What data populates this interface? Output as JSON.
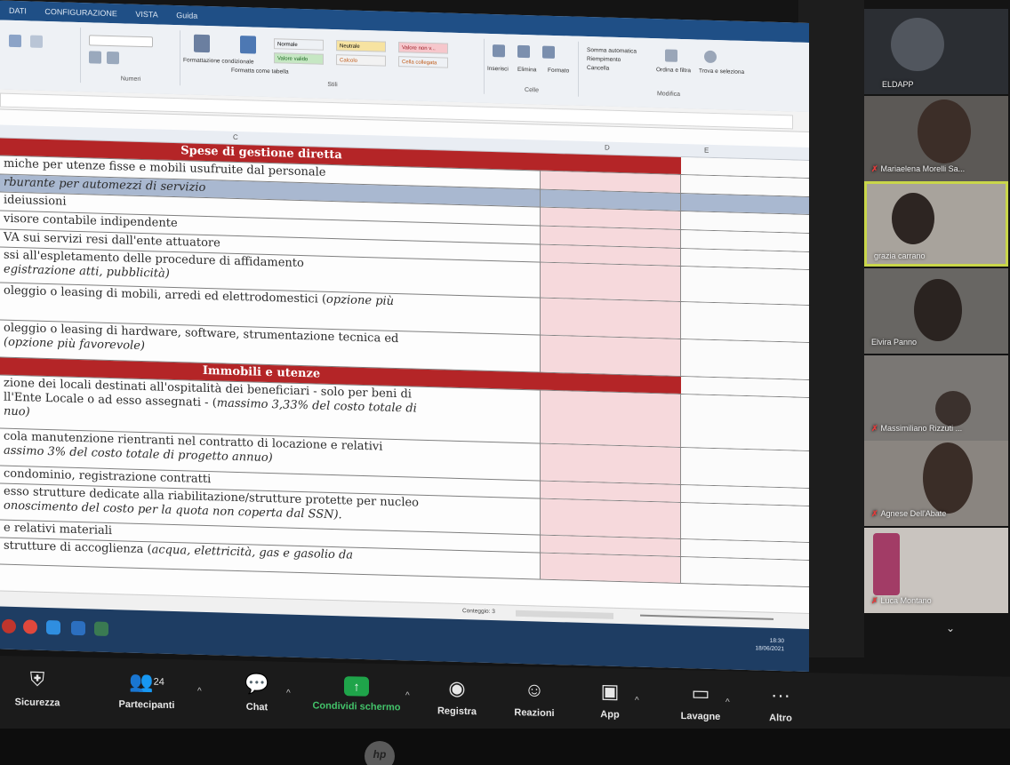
{
  "excel": {
    "titlebar": [
      "DATI",
      "CONFIGURAZIONE",
      "VISTA",
      "Guida"
    ],
    "ribbon": {
      "style_cells": [
        {
          "label": "Normale",
          "bg": "#ffffff"
        },
        {
          "label": "Neutrale",
          "bg": "#f7e3a1"
        },
        {
          "label": "Valore non v...",
          "bg": "#f6c7cc"
        },
        {
          "label": "Valore valido",
          "bg": "#c6e7c3"
        },
        {
          "label": "Calcolo",
          "bg": "#f2f2f2"
        },
        {
          "label": "Cella collegata",
          "bg": "#ffffff"
        }
      ],
      "groups": [
        "Numeri",
        "Stili",
        "Celle",
        "Modifica"
      ],
      "buttons": [
        "Formattazione condizionale",
        "Formatta come tabella",
        "Inserisci",
        "Elimina",
        "Formato",
        "Somma automatica",
        "Riempimento",
        "Cancella",
        "Ordina e filtra",
        "Trova e seleziona"
      ]
    },
    "columns": [
      "C",
      "D",
      "E"
    ],
    "rows": [
      {
        "type": "header",
        "text": "Spese di gestione diretta",
        "h": 20
      },
      {
        "type": "plain",
        "text": "miche per utenze fisse e mobili usufruite dal personale",
        "h": 21
      },
      {
        "type": "blue",
        "text": "rburante per automezzi di servizio",
        "h": 20
      },
      {
        "type": "plain",
        "text": "ideiussioni",
        "h": 21
      },
      {
        "type": "plain",
        "text": "visore contabile indipendente",
        "h": 21
      },
      {
        "type": "plain",
        "text": "VA sui servizi resi dall'ente attuatore",
        "h": 20
      },
      {
        "type": "plain",
        "text": "ssi all'espletamento delle procedure di affidamento",
        "text2_it": "egistrazione atti, pubblicità)",
        "h": 40
      },
      {
        "type": "plain",
        "text": "oleggio o leasing di mobili, arredi ed elettrodomestici (",
        "text_it": "opzione più",
        "h": 42
      },
      {
        "type": "plain",
        "text": "oleggio o leasing di hardware, software, strumentazione tecnica ed",
        "text2_it": "(opzione più favorevole)",
        "h": 42
      },
      {
        "type": "header",
        "text": "Immobili e utenze",
        "h": 20
      },
      {
        "type": "plain",
        "text": "zione dei locali destinati all'ospitalità dei beneficiari - solo per beni di",
        "text2": "ll'Ente Locale  o ad esso assegnati - (",
        "text2_it": "massimo 3,33% del costo totale di",
        "text3_it": "nuo)",
        "h": 60
      },
      {
        "type": "plain",
        "text": "cola manutenzione rientranti nel contratto di locazione e relativi",
        "text2_it": "assimo 3% del costo totale di progetto annuo)",
        "h": 42
      },
      {
        "type": "plain",
        "text": "condominio, registrazione contratti",
        "h": 20
      },
      {
        "type": "plain",
        "text": "esso strutture dedicate alla riabilitazione/strutture protette per nucleo",
        "text2_it": "onoscimento del costo per la quota non coperta dal SSN).",
        "h": 41
      },
      {
        "type": "plain",
        "text": "e relativi materiali",
        "h": 20
      },
      {
        "type": "plain",
        "text": "strutture di accoglienza (",
        "text_it": "acqua, elettricità, gas e gasolio da",
        "h": 30
      }
    ],
    "status": "Conteggio: 3",
    "clock": {
      "time": "18:30",
      "date": "18/06/2021"
    }
  },
  "participants": [
    {
      "name": "ELDAPP",
      "muted": false
    },
    {
      "name": "Mariaelena Morelli Sa...",
      "muted": true
    },
    {
      "name": "grazia carrano",
      "muted": false,
      "active": true
    },
    {
      "name": "Elvira Panno",
      "muted": false
    },
    {
      "name": "Massimiliano Rizzuti ...",
      "muted": true
    },
    {
      "name": "Agnese Dell'Abate",
      "muted": true
    },
    {
      "name": "Luca Montano",
      "muted": true
    }
  ],
  "toolbar": {
    "security": "Sicurezza",
    "participants_count": "24",
    "participants": "Partecipanti",
    "chat": "Chat",
    "share": "Condividi schermo",
    "record": "Registra",
    "reactions": "Reazioni",
    "apps": "App",
    "whiteboards": "Lavagne",
    "more": "Altro"
  },
  "colors": {
    "header_red": "#b42527",
    "blue_row": "#a9b8d0",
    "pink_cell": "#f6d9dc",
    "share_green": "#1fa44a",
    "active_border": "#c9d64a"
  }
}
